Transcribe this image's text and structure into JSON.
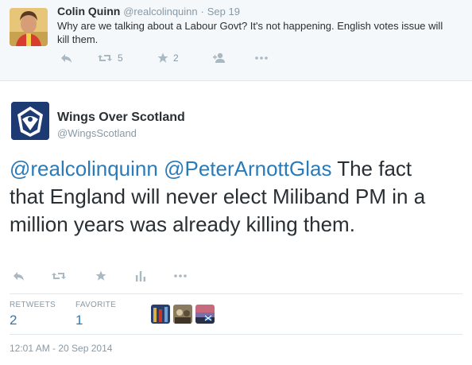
{
  "parent_tweet": {
    "name": "Colin Quinn",
    "handle": "@realcolinquinn",
    "separator": "·",
    "date": "Sep 19",
    "text": "Why are we talking about a Labour Govt? It's not happening. English votes issue will kill them.",
    "retweet_count": "5",
    "favorite_count": "2"
  },
  "main_tweet": {
    "name": "Wings Over Scotland",
    "handle": "@WingsScotland",
    "mention1": "@realcolinquinn",
    "mention2": "@PeterArnottGlas",
    "text": " The fact that England will never elect Miliband PM in a million years was already killing them.",
    "stats": {
      "retweets_label": "RETWEETS",
      "retweets_value": "2",
      "favorites_label": "FAVORITE",
      "favorites_value": "1"
    },
    "timestamp": "12:01 AM - 20 Sep 2014"
  },
  "icons": [
    "reply-icon",
    "retweet-icon",
    "favorite-icon",
    "follow-icon",
    "more-icon",
    "analytics-icon"
  ],
  "colors": {
    "link": "#2b7bb9",
    "muted": "#8899a6",
    "text": "#292f33",
    "parent_bg": "#f5f8fa"
  }
}
